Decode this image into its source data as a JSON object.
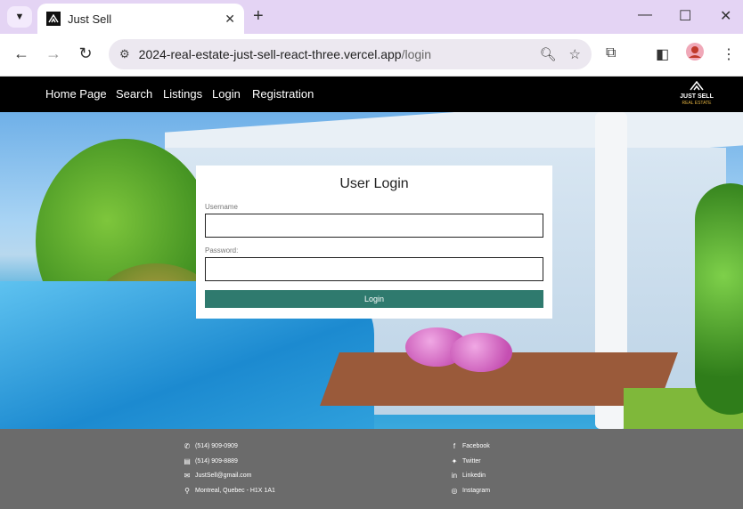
{
  "browser": {
    "tab_title": "Just Sell",
    "url_host": "2024-real-estate-just-sell-react-three.vercel.app",
    "url_path": "/login"
  },
  "nav": {
    "items": [
      "Home Page",
      "Search",
      "Listings",
      "Login",
      "Registration"
    ],
    "logo_title": "JUST SELL",
    "logo_subtitle": "REAL ESTATE"
  },
  "login": {
    "heading": "User Login",
    "username_label": "Username",
    "password_label": "Password:",
    "button_label": "Login",
    "button_color": "#2f7a6e"
  },
  "footer": {
    "contact": [
      "(514) 909-0909",
      "(514) 909-8889",
      "JustSell@gmail.com",
      "Montreal, Quebec - H1X 1A1"
    ],
    "social": [
      "Facebook",
      "Twitter",
      "Linkedin",
      "Instagram"
    ]
  }
}
